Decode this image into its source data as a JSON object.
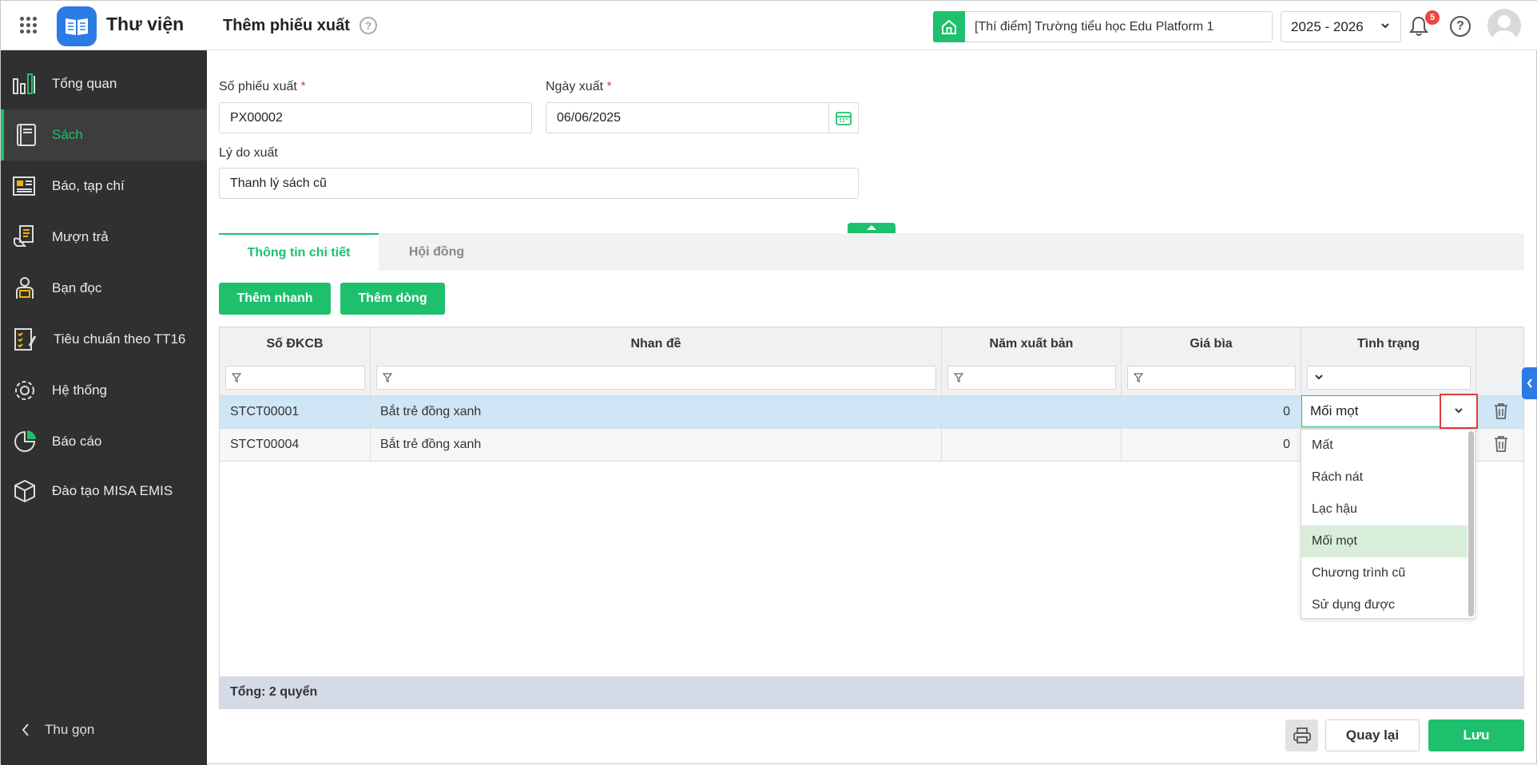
{
  "app": {
    "title": "Thư viện",
    "page_title": "Thêm phiếu xuất"
  },
  "header": {
    "school": "[Thí điểm] Trường tiểu học Edu Platform 1",
    "year": "2025 - 2026",
    "notification_count": "5"
  },
  "sidebar": {
    "items": [
      {
        "label": "Tổng quan",
        "icon": "chart-icon"
      },
      {
        "label": "Sách",
        "icon": "book-icon",
        "active": true
      },
      {
        "label": "Báo, tạp chí",
        "icon": "newspaper-icon"
      },
      {
        "label": "Mượn trả",
        "icon": "borrow-icon"
      },
      {
        "label": "Bạn đọc",
        "icon": "reader-icon"
      },
      {
        "label": "Tiêu chuẩn theo TT16",
        "icon": "checklist-icon"
      },
      {
        "label": "Hệ thống",
        "icon": "gear-icon"
      },
      {
        "label": "Báo cáo",
        "icon": "pie-chart-icon"
      },
      {
        "label": "Đào tạo MISA EMIS",
        "icon": "cube-icon"
      }
    ],
    "collapse_label": "Thu gọn"
  },
  "form": {
    "voucher_no_label": "Số phiếu xuất",
    "voucher_no": "PX00002",
    "date_label": "Ngày xuất",
    "date": "06/06/2025",
    "reason_label": "Lý do xuất",
    "reason": "Thanh lý sách cũ",
    "required_mark": "*"
  },
  "tabs": [
    "Thông tin chi tiết",
    "Hội đồng"
  ],
  "buttons": {
    "quick_add": "Thêm nhanh",
    "add_row": "Thêm dòng",
    "back": "Quay lại",
    "save": "Lưu"
  },
  "table": {
    "columns": [
      "Số ĐKCB",
      "Nhan đề",
      "Năm xuất bản",
      "Giá bìa",
      "Tình trạng"
    ],
    "rows": [
      {
        "code": "STCT00001",
        "title": "Bắt trẻ đồng xanh",
        "year": "",
        "price": "0",
        "status": "Mối mọt"
      },
      {
        "code": "STCT00004",
        "title": "Bắt trẻ đồng xanh",
        "year": "",
        "price": "0",
        "status": ""
      }
    ],
    "footer": "Tổng: 2 quyển"
  },
  "status_options": [
    "Mất",
    "Rách nát",
    "Lạc hậu",
    "Mối mọt",
    "Chương trình cũ",
    "Sử dụng được"
  ],
  "status_selected": "Mối mọt",
  "colors": {
    "accent": "#1ec06e",
    "sidebar": "#303030",
    "brand_blue": "#2b7be4",
    "row_selected": "#cfe6f7"
  }
}
